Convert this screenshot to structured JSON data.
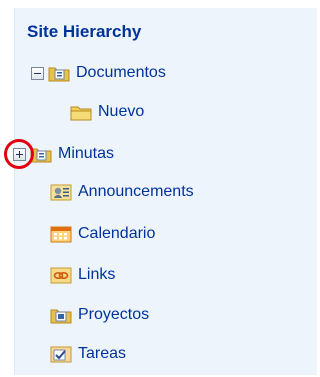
{
  "sidebar": {
    "title": "Site Hierarchy",
    "items": [
      {
        "label": "Documentos"
      },
      {
        "label": "Nuevo"
      },
      {
        "label": "Minutas"
      },
      {
        "label": "Announcements"
      },
      {
        "label": "Calendario"
      },
      {
        "label": "Links"
      },
      {
        "label": "Proyectos"
      },
      {
        "label": "Tareas"
      }
    ]
  },
  "colors": {
    "panel_background": "#edf4fc",
    "link": "#003399",
    "callout_circle": "#e2000f"
  },
  "icons": {
    "collapse": "minus-box-icon",
    "expand": "plus-box-icon",
    "library": "document-library-icon",
    "folder": "folder-icon",
    "announcements": "announcements-list-icon",
    "calendar": "calendar-list-icon",
    "links": "links-list-icon",
    "tasks": "tasks-list-icon"
  }
}
